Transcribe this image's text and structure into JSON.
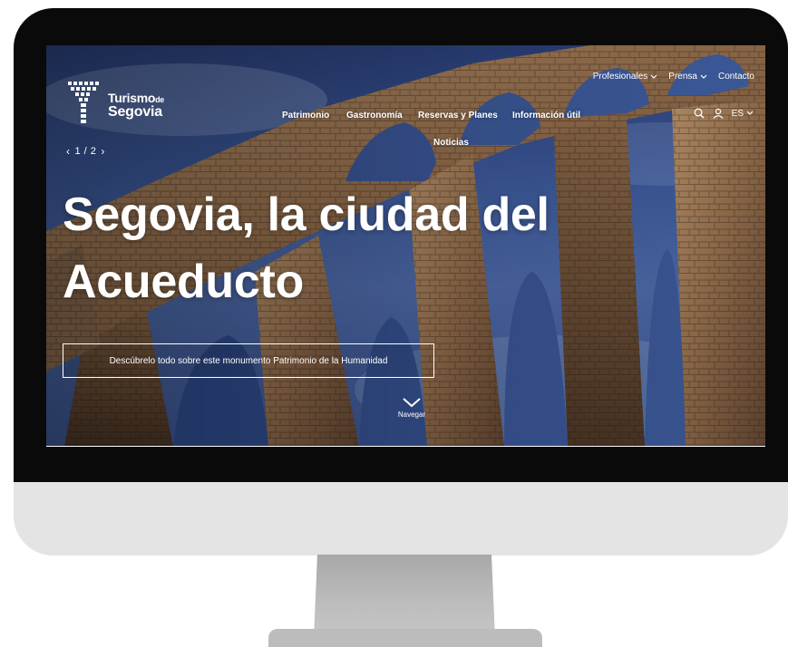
{
  "brand": {
    "logo_line1": "Turismo",
    "logo_de": "de",
    "logo_line2": "Segovia"
  },
  "nav_top": {
    "items": [
      {
        "label": "Profesionales",
        "has_dropdown": true
      },
      {
        "label": "Prensa",
        "has_dropdown": true
      },
      {
        "label": "Contacto",
        "has_dropdown": false
      }
    ]
  },
  "nav_main": {
    "items": [
      {
        "label": "Patrimonio"
      },
      {
        "label": "Gastronomía"
      },
      {
        "label": "Reservas y Planes"
      },
      {
        "label": "Información útil"
      },
      {
        "label": "Noticias"
      }
    ]
  },
  "tools": {
    "search_icon": "search-icon",
    "user_icon": "user-icon",
    "language": "ES"
  },
  "slider": {
    "pager": "1 / 2",
    "current": 1,
    "total": 2
  },
  "hero": {
    "title_line1": "Segovia, la ciudad del",
    "title_line2": "Acueducto",
    "cta_label": "Descúbrelo todo sobre este monumento Patrimonio de la Humanidad",
    "scroll_label": "Navegar"
  },
  "colors": {
    "sky": "#3d5a9c",
    "stone": "#a07c5a",
    "text": "#ffffff",
    "bezel": "#0a0a0a",
    "chin": "#e4e4e4"
  }
}
